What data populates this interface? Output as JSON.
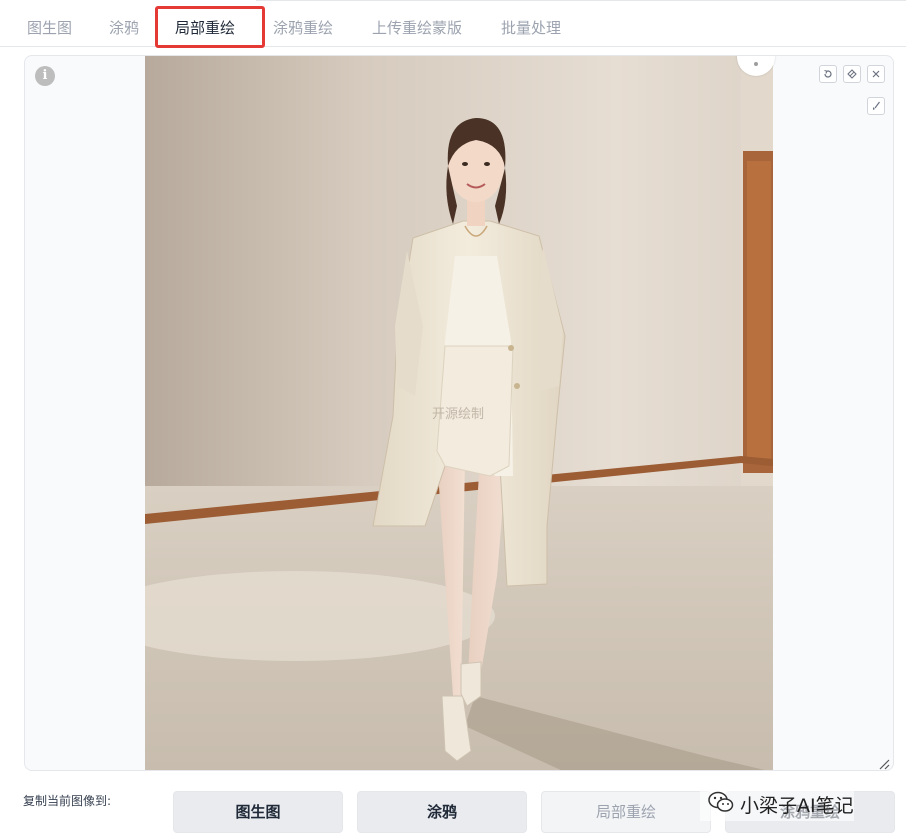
{
  "tabs": [
    {
      "label": "图生图",
      "selected": false
    },
    {
      "label": "涂鸦",
      "selected": false
    },
    {
      "label": "局部重绘",
      "selected": true
    },
    {
      "label": "涂鸦重绘",
      "selected": false
    },
    {
      "label": "上传重绘蒙版",
      "selected": false
    },
    {
      "label": "批量处理",
      "selected": false
    }
  ],
  "highlight_color": "#e53935",
  "canvas": {
    "info_icon": "info-icon",
    "tools": [
      "undo-icon",
      "eraser-icon",
      "close-icon",
      "brush-icon"
    ],
    "image_watermark": "开源绘制"
  },
  "copy_to": {
    "label": "复制当前图像到:",
    "buttons": [
      {
        "label": "图生图",
        "disabled": false
      },
      {
        "label": "涂鸦",
        "disabled": false
      },
      {
        "label": "局部重绘",
        "disabled": true
      },
      {
        "label": "涂鸦重绘",
        "disabled": false
      }
    ]
  },
  "watermark": {
    "text": "小梁子AI笔记",
    "icon": "wechat-icon"
  }
}
